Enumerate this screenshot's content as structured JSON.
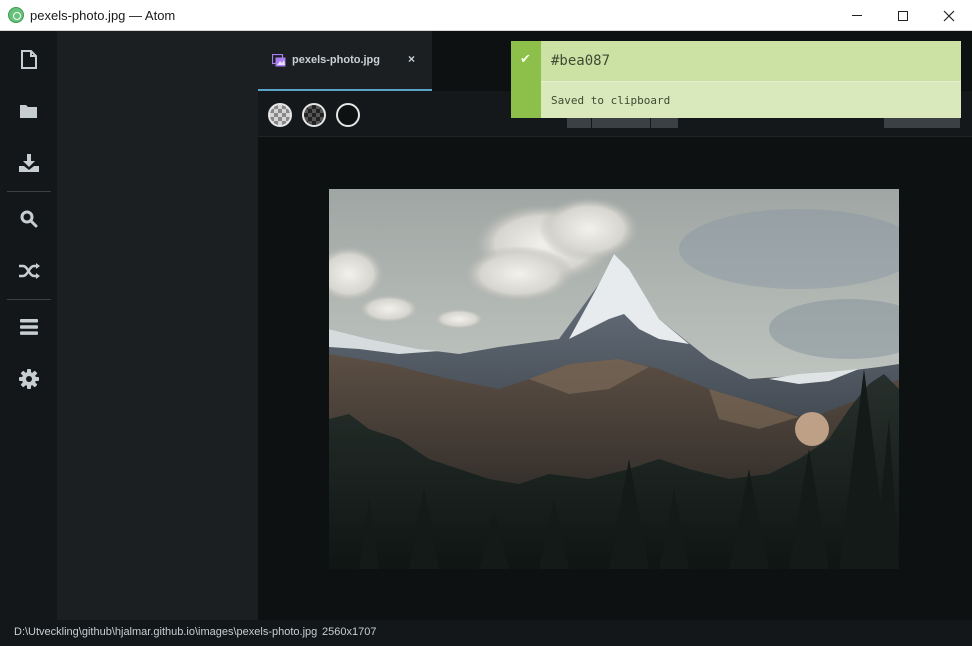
{
  "window": {
    "title": "pexels-photo.jpg — Atom"
  },
  "dock": {
    "items": [
      {
        "icon": "file-icon"
      },
      {
        "icon": "folder-icon"
      },
      {
        "icon": "download-icon"
      },
      {
        "icon": "search-icon"
      },
      {
        "icon": "shuffle-icon"
      },
      {
        "icon": "menu-icon"
      },
      {
        "icon": "gear-icon"
      }
    ]
  },
  "tab": {
    "title": "pexels-photo.jpg",
    "close_symbol": "×",
    "icon": "image-icon"
  },
  "notification": {
    "title": "#bea087",
    "detail": "Saved to clipboard",
    "check_symbol": "✔",
    "colors": {
      "side": "#8cc04b",
      "body": "#cce2a4",
      "picked": "#bea087"
    }
  },
  "status": {
    "path": "D:\\Utveckling\\github\\hjalmar.github.io\\images\\pexels-photo.jpg",
    "size": "2560x1707"
  },
  "colors": {
    "accent": "#5aa3c8",
    "dock_bg": "#131719",
    "editor_bg": "#0d1112"
  }
}
